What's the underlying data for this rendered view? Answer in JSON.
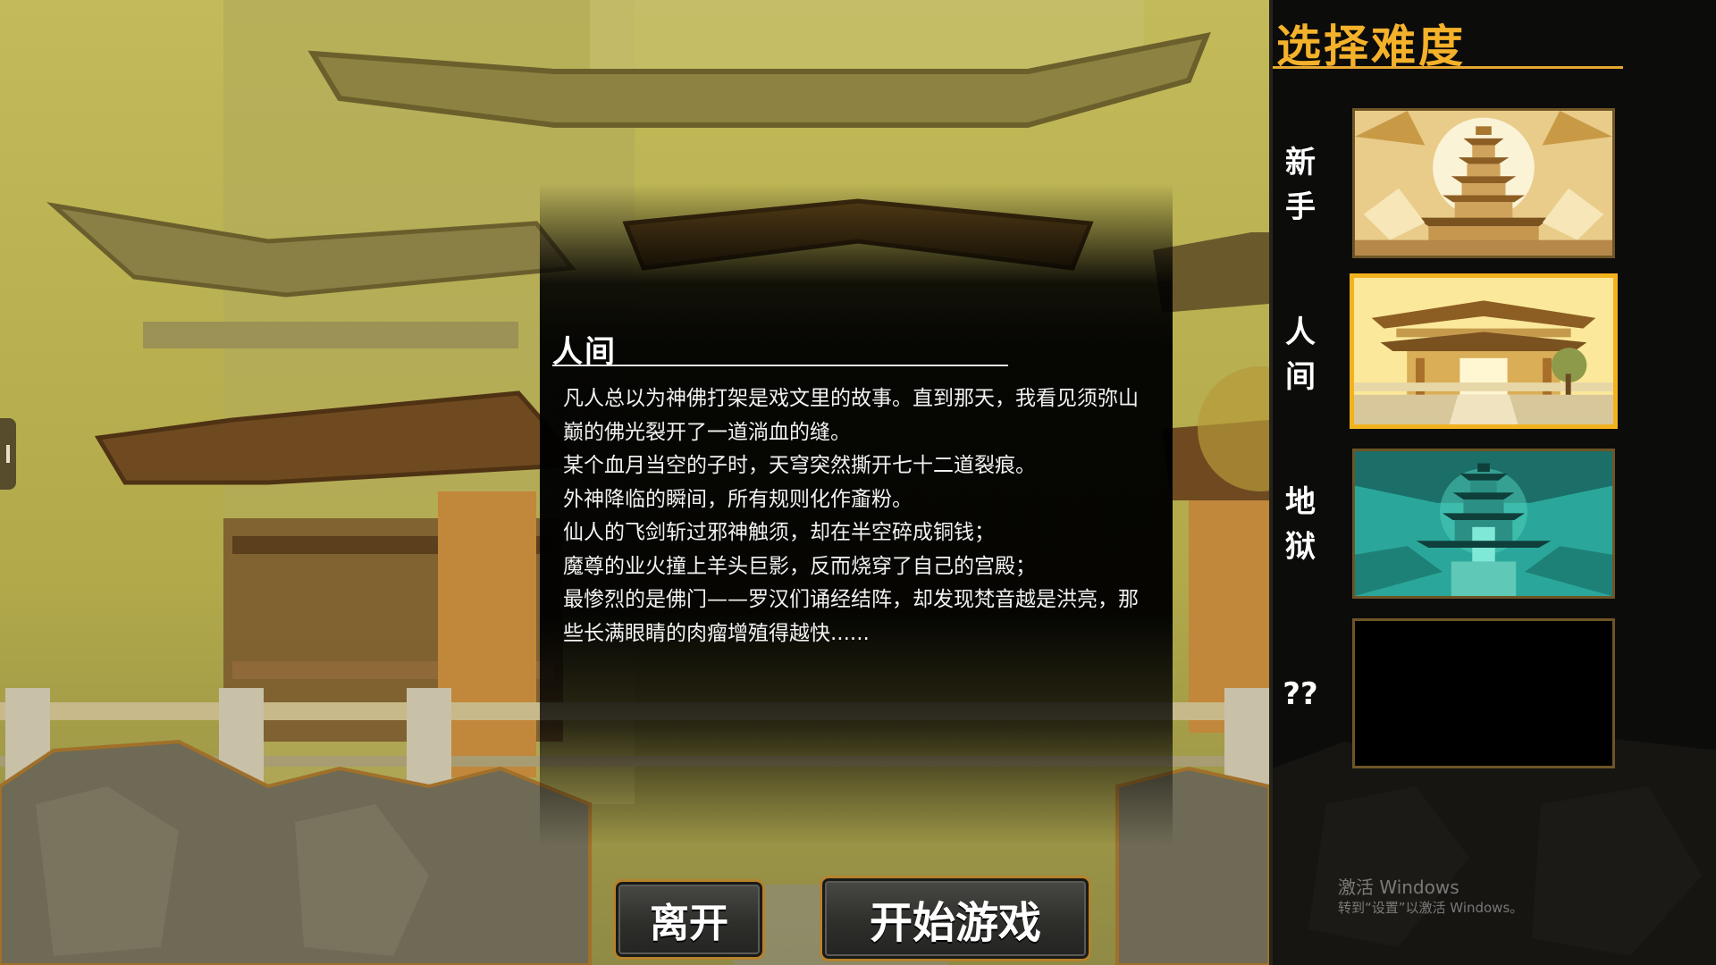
{
  "story": {
    "title": "人间",
    "paragraphs": [
      "凡人总以为神佛打架是戏文里的故事。直到那天，我看见须弥山巅的佛光裂开了一道淌血的缝。",
      "某个血月当空的子时，天穹突然撕开七十二道裂痕。",
      "外神降临的瞬间，所有规则化作齑粉。",
      "仙人的飞剑斩过邪神触须，却在半空碎成铜钱；",
      "魔尊的业火撞上羊头巨影，反而烧穿了自己的宫殿；",
      "最惨烈的是佛门——罗汉们诵经结阵，却发现梵音越是洪亮，那些长满眼睛的肉瘤增殖得越快......"
    ]
  },
  "buttons": {
    "leave_label": "离开",
    "start_label": "开始游戏"
  },
  "difficulty": {
    "title": "选择难度",
    "selected_index": 1,
    "items": [
      {
        "label": "新手",
        "label_lines": [
          "新",
          "手"
        ],
        "art": "golden-pagoda-moon",
        "locked": false
      },
      {
        "label": "人间",
        "label_lines": [
          "人",
          "间"
        ],
        "art": "palace-gate",
        "locked": false
      },
      {
        "label": "地狱",
        "label_lines": [
          "地",
          "狱"
        ],
        "art": "jade-underworld-pagoda",
        "locked": false
      },
      {
        "label": "??",
        "label_lines": [
          "??"
        ],
        "art": "none",
        "locked": true
      }
    ]
  },
  "watermark": {
    "title": "激活 Windows",
    "subtitle": "转到“设置”以激活 Windows。"
  },
  "colors": {
    "accent_gold": "#f4b12a",
    "selected_border": "#f2b21e",
    "panel_bg": "#0c0c0b",
    "scene_olive": "#b9b04d"
  }
}
